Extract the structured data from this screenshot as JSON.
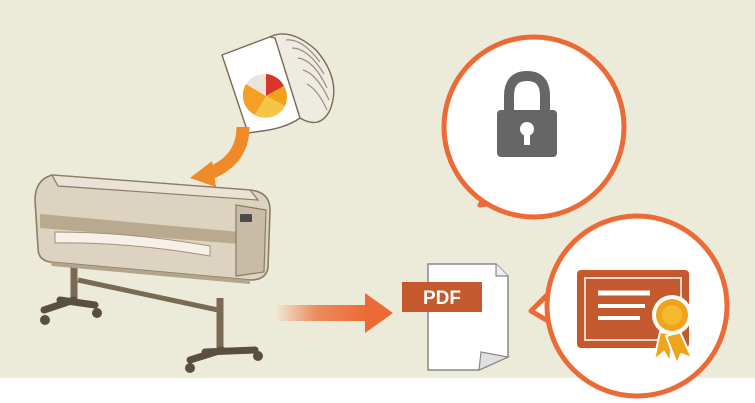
{
  "pdf_badge_label": "PDF",
  "colors": {
    "panel_background": "#ecebd9",
    "page_background": "#ffffff",
    "accent_orange": "#ec6a35",
    "arrow_orange": "#f08a28",
    "lock_gray": "#666666",
    "certificate_brown": "#c3592c",
    "seal_orange": "#f0a31c",
    "printer_beige": "#ddd3c1",
    "printer_shadow": "#b3a48c",
    "paper_white": "#ffffff"
  },
  "icons": [
    "document-with-pie-chart-icon",
    "curved-arrow-icon",
    "large-format-printer-icon",
    "scan-output-arrow-icon",
    "pdf-document-icon",
    "padlock-icon",
    "certificate-icon"
  ]
}
